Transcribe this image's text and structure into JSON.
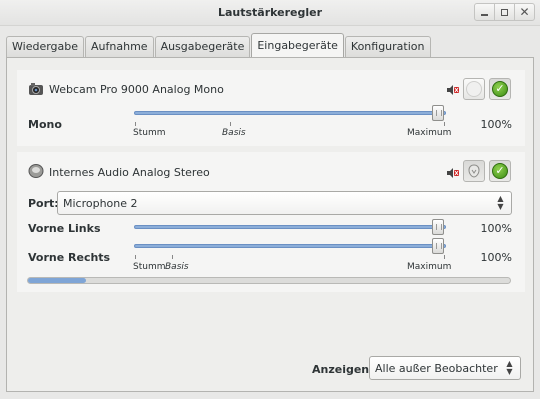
{
  "window": {
    "title": "Lautstärkeregler"
  },
  "tabs": [
    {
      "label": "Wiedergabe"
    },
    {
      "label": "Aufnahme"
    },
    {
      "label": "Ausgabegeräte"
    },
    {
      "label": "Eingabegeräte"
    },
    {
      "label": "Konfiguration"
    }
  ],
  "active_tab": "Eingabegeräte",
  "devices": [
    {
      "name": "Webcam Pro 9000 Analog Mono",
      "icon": "webcam-icon",
      "channels": [
        {
          "label": "Mono",
          "percent": "100%",
          "value_fraction": 1.0
        }
      ],
      "scale_labels": {
        "min": "Stumm",
        "base": "Basis",
        "max": "Maximum"
      },
      "is_default": true
    },
    {
      "name": "Internes Audio Analog Stereo",
      "icon": "sound-card-icon",
      "port_label": "Port:",
      "port_value": "Microphone 2",
      "channels": [
        {
          "label": "Vorne Links",
          "percent": "100%",
          "value_fraction": 1.0
        },
        {
          "label": "Vorne Rechts",
          "percent": "100%",
          "value_fraction": 1.0
        }
      ],
      "scale_labels": {
        "min": "Stumm",
        "base": "Basis",
        "max": "Maximum"
      },
      "is_default": true
    }
  ],
  "footer": {
    "show_label": "Anzeigen:",
    "show_value": "Alle außer Beobachter"
  },
  "colors": {
    "slider_fill": "#8caed9",
    "check_green": "#3c8c13"
  }
}
